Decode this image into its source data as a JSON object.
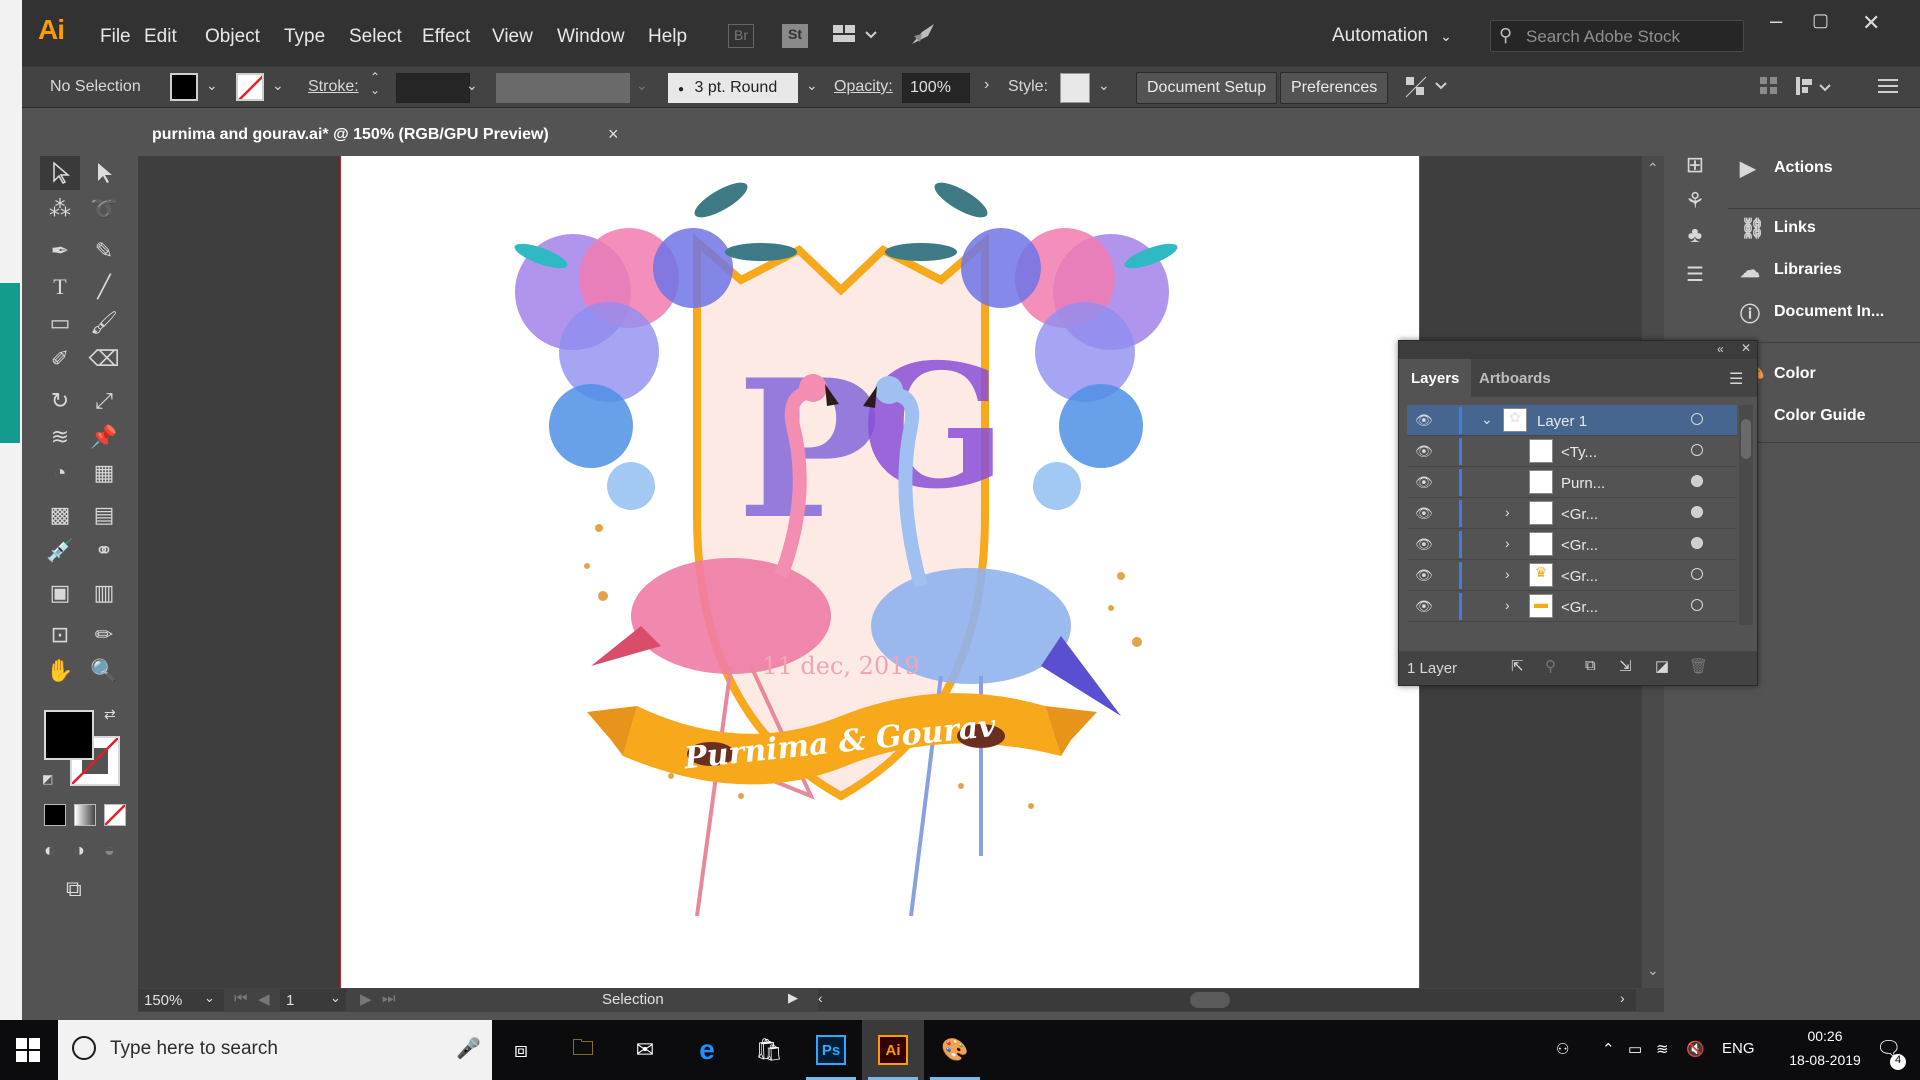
{
  "app": {
    "logo": "Ai",
    "menu": [
      "File",
      "Edit",
      "Object",
      "Type",
      "Select",
      "Effect",
      "View",
      "Window",
      "Help"
    ],
    "bridge_label": "Br",
    "stock_label": "St",
    "workspace": "Automation",
    "search_placeholder": "Search Adobe Stock"
  },
  "control": {
    "selection_status": "No Selection",
    "stroke_label": "Stroke:",
    "brush_label": "3 pt. Round",
    "opacity_label": "Opacity:",
    "opacity_value": "100%",
    "style_label": "Style:",
    "document_setup": "Document Setup",
    "preferences": "Preferences"
  },
  "document": {
    "tab_title": "purnima and gourav.ai* @ 150% (RGB/GPU Preview)",
    "close": "×"
  },
  "artwork": {
    "monogram_left": "P",
    "monogram_right": "G",
    "date": "11 dec, 2019",
    "banner": "Purnima & Gourav",
    "colors": {
      "gold": "#f7a81b",
      "pink": "#ef7ba6",
      "blue": "#79a6e6",
      "purple": "#8a4fd8"
    }
  },
  "status": {
    "zoom": "150%",
    "artboard_number": "1",
    "tool": "Selection"
  },
  "dock": {
    "items": [
      {
        "label": "Actions",
        "icon": "play-icon"
      },
      {
        "label": "Links",
        "icon": "link-icon"
      },
      {
        "label": "Libraries",
        "icon": "cc-libraries-icon"
      },
      {
        "label": "Document In...",
        "icon": "info-icon"
      },
      {
        "label": "Color",
        "icon": "palette-icon"
      },
      {
        "label": "Color Guide",
        "icon": "color-guide-icon"
      }
    ]
  },
  "layers": {
    "tabs": [
      "Layers",
      "Artboards"
    ],
    "rows": [
      {
        "name": "Layer 1",
        "expanded": true
      },
      {
        "name": "<Ty..."
      },
      {
        "name": "Purn..."
      },
      {
        "name": "<Gr..."
      },
      {
        "name": "<Gr..."
      },
      {
        "name": "<Gr..."
      },
      {
        "name": "<Gr..."
      }
    ],
    "count": "1 Layer"
  },
  "taskbar": {
    "search_placeholder": "Type here to search",
    "language": "ENG",
    "time": "00:26",
    "date": "18-08-2019",
    "notifications": "4"
  }
}
